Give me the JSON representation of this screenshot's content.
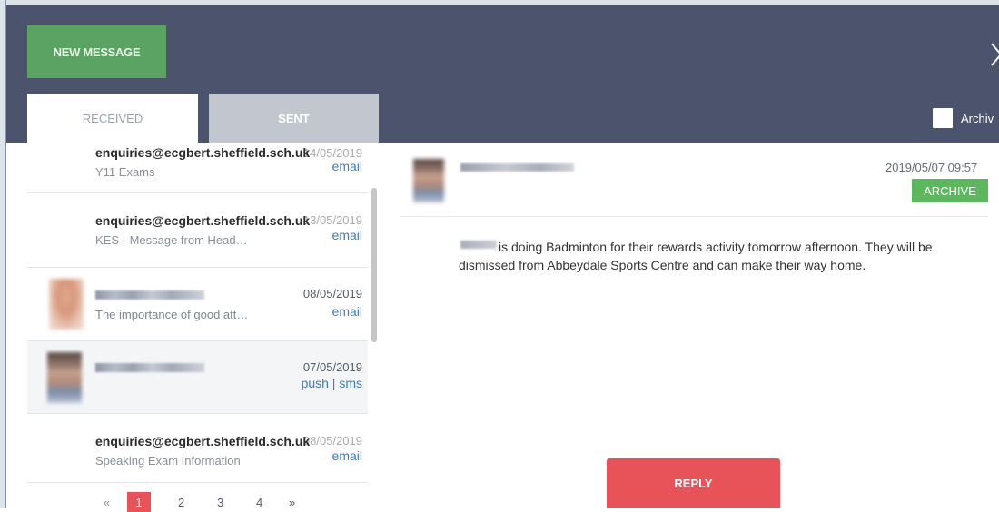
{
  "header": {
    "new_message_label": "NEW MESSAGE",
    "close_icon": "close-icon",
    "tabs": {
      "received": "RECEIVED",
      "sent": "SENT"
    },
    "archive_label": "Archiv"
  },
  "messages": [
    {
      "sender": "enquiries@ecgbert.sheffield.sch.uk",
      "date": "14/05/2019",
      "subject": "Y11 Exams",
      "channel": "email",
      "sender_shown": true
    },
    {
      "sender": "enquiries@ecgbert.sheffield.sch.uk",
      "date": "13/05/2019",
      "subject": "KES - Message from Head…",
      "channel": "email",
      "sender_shown": true
    },
    {
      "sender": "",
      "date": "08/05/2019",
      "subject": "The importance of good att…",
      "channel": "email",
      "sender_shown": false
    },
    {
      "sender": "",
      "date": "07/05/2019",
      "subject": "",
      "channel": "push | sms",
      "sender_shown": false
    },
    {
      "sender": "enquiries@ecgbert.sheffield.sch.uk",
      "date": "08/05/2019",
      "subject": "Speaking Exam Information",
      "channel": "email",
      "sender_shown": true
    }
  ],
  "pagination": {
    "prev": "«",
    "pages": [
      "1",
      "2",
      "3",
      "4"
    ],
    "current": "1",
    "next": "»"
  },
  "detail": {
    "date": "2019/05/07 09:57",
    "archive_label": "ARCHIVE",
    "body": "is doing Badminton for their rewards activity tomorrow afternoon. They will be dismissed from Abbeydale Sports Centre and can make their way home.",
    "reply_label": "REPLY"
  },
  "colors": {
    "header_bg": "#4b546c",
    "new_message_bg": "#5aa362",
    "archive_green": "#5cb85c",
    "reply_red": "#e8535a",
    "link_blue": "#3f7bbd"
  }
}
